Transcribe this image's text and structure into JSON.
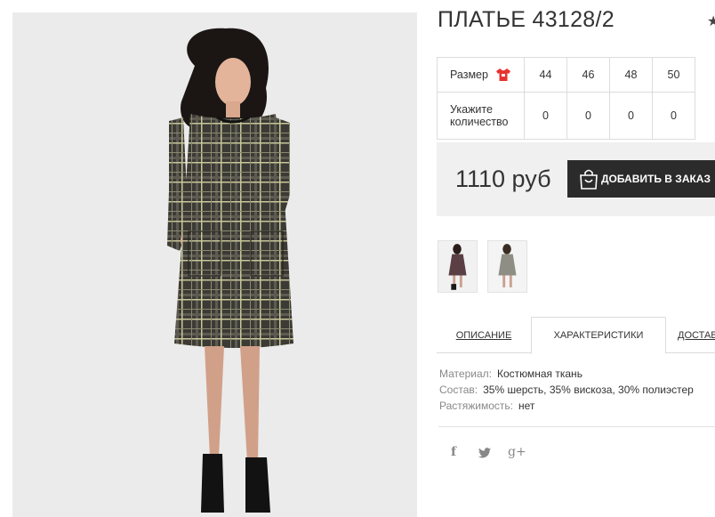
{
  "product": {
    "title": "ПЛАТЬЕ 43128/2",
    "main_image": "product-photo-dress-plaid"
  },
  "sizes": {
    "size_label": "Размер",
    "qty_label_line1": "Укажите",
    "qty_label_line2": "количество",
    "values": [
      "44",
      "46",
      "48",
      "50"
    ],
    "quantities": [
      "0",
      "0",
      "0",
      "0"
    ]
  },
  "purchase": {
    "price": "1110 руб",
    "add_to_cart": "ДОБАВИТЬ В ЗАКАЗ"
  },
  "tabs": [
    {
      "label": "ОПИСАНИЕ",
      "active": false
    },
    {
      "label": "ХАРАКТЕРИСТИКИ",
      "active": true
    },
    {
      "label": "ДОСТАВКА",
      "active": false
    }
  ],
  "characteristics": [
    {
      "label": "Материал:",
      "value": "Костюмная ткань"
    },
    {
      "label": "Состав:",
      "value": "35% шерсть, 35% вискоза, 30% полиэстер"
    },
    {
      "label": "Растяжимость:",
      "value": "нет"
    }
  ],
  "social": {
    "facebook": "f",
    "twitter": "🐦",
    "googleplus": "g+"
  },
  "colors": {
    "button_bg": "#2b2b2b",
    "price_bg": "#f0f0f0",
    "tshirt_red": "#e8322f"
  }
}
